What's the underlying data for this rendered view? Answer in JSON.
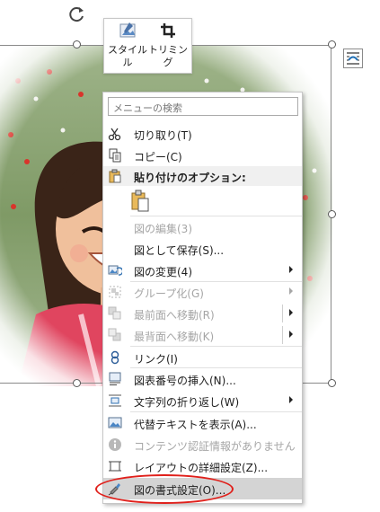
{
  "toolbar": {
    "style_label": "スタイル",
    "trim_label": "トリミング"
  },
  "menu": {
    "search_placeholder": "メニューの検索",
    "paste_options_header": "貼り付けのオプション:",
    "items": {
      "cut": "切り取り(T)",
      "copy": "コピー(C)",
      "edit_picture": "図の編集(3)",
      "save_as_picture": "図として保存(S)...",
      "change_picture": "図の変更(4)",
      "group": "グループ化(G)",
      "bring_to_front": "最前面へ移動(R)",
      "send_to_back": "最背面へ移動(K)",
      "link": "リンク(I)",
      "insert_caption": "図表番号の挿入(N)...",
      "wrap_text": "文字列の折り返し(W)",
      "view_alt_text": "代替テキストを表示(A)...",
      "content_credentials": "コンテンツ認証情報がありません",
      "layout_details": "レイアウトの詳細設定(Z)...",
      "format_picture": "図の書式設定(O)..."
    }
  },
  "colors": {
    "highlight": "#d4d4d4",
    "annotation_oval": "#e0201b",
    "disabled_text": "#a6a6a6"
  }
}
